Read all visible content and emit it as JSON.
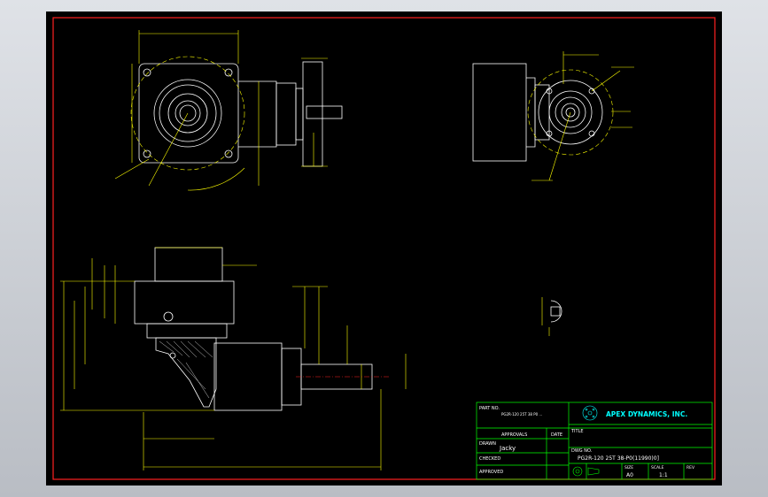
{
  "colors": {
    "background": "#000000",
    "border": "#ff2020",
    "outline": "#ffffff",
    "dimension": "#ffff00",
    "titleblock": "#00ff00",
    "text": "#ffffff",
    "logo": "#00ffff"
  },
  "title_block": {
    "part_no_label": "PART NO.",
    "part_no_value": "PG2R-120 25T 38 P0 ...",
    "title_label": "TITLE",
    "approvals_label": "APPROVALS",
    "date_label": "DATE",
    "drawn_label": "DRAWN",
    "drawn_value": "Jacky",
    "checked_label": "CHECKED",
    "approved_label": "APPROVED",
    "company": "APEX DYNAMICS, INC.",
    "dwg_no_label": "DWG NO.",
    "dwg_no_value": "PG2R-120 25T 38-P0(11990)0]",
    "size_label": "SIZE",
    "size_value": "A0",
    "scale_label": "SCALE",
    "scale_value": "1:1",
    "rev_label": "REV"
  }
}
